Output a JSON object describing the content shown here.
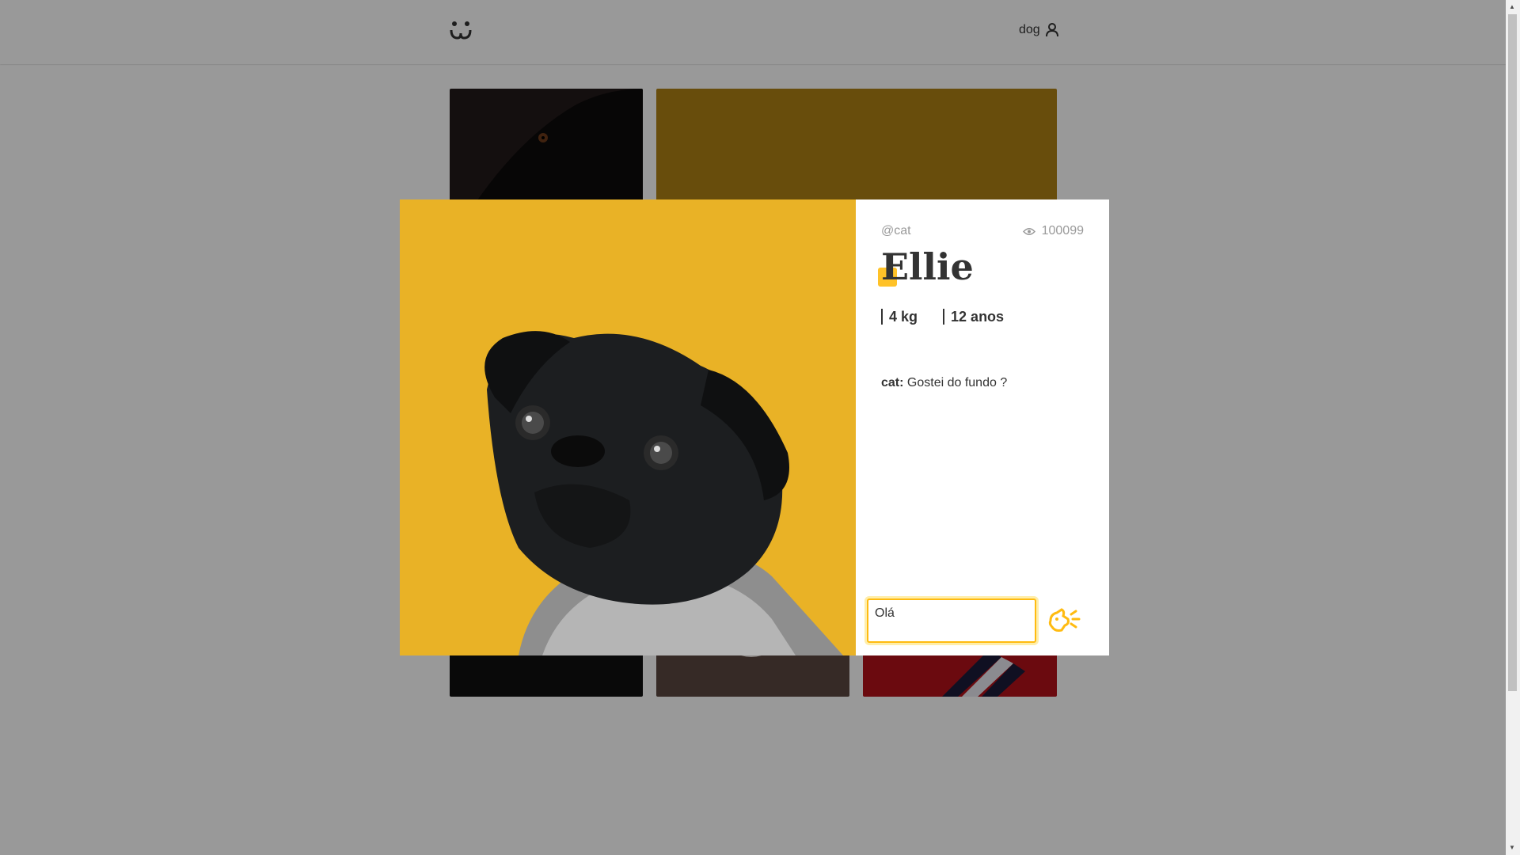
{
  "header": {
    "user_label": "dog"
  },
  "modal": {
    "author": "@cat",
    "views": "100099",
    "title": "Ellie",
    "attributes": [
      "4 kg",
      "12 anos"
    ],
    "comments": [
      {
        "author": "cat:",
        "text": " Gostei do fundo ?"
      }
    ],
    "comment_input": {
      "value": "Olá"
    }
  },
  "colors": {
    "accent": "#ffbb11",
    "photo_background": "#e9b226"
  },
  "icons": {
    "logo": "dog-face-icon",
    "user": "user-icon",
    "views": "eye-icon",
    "send": "bark-send-icon"
  }
}
